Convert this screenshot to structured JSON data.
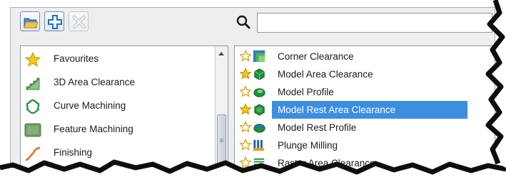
{
  "toolbar": {
    "buttons": [
      {
        "name": "open-folder",
        "icon": "folder-open-icon"
      },
      {
        "name": "add",
        "icon": "plus-icon"
      },
      {
        "name": "remove",
        "icon": "x-icon",
        "disabled": true
      }
    ]
  },
  "search": {
    "icon": "search-icon",
    "value": "",
    "placeholder": ""
  },
  "categories": [
    {
      "label": "Favourites",
      "icon": "star-icon"
    },
    {
      "label": "3D Area Clearance",
      "icon": "area-clearance-icon"
    },
    {
      "label": "Curve Machining",
      "icon": "curve-icon"
    },
    {
      "label": "Feature Machining",
      "icon": "feature-icon"
    },
    {
      "label": "Finishing",
      "icon": "finishing-icon"
    }
  ],
  "strategies": [
    {
      "label": "Corner Clearance",
      "favourite": false,
      "icon": "corner-clearance-icon"
    },
    {
      "label": "Model Area Clearance",
      "favourite": true,
      "icon": "model-area-clearance-icon"
    },
    {
      "label": "Model Profile",
      "favourite": false,
      "icon": "model-profile-icon"
    },
    {
      "label": "Model Rest Area Clearance",
      "favourite": true,
      "selected": true,
      "icon": "model-rest-area-clearance-icon"
    },
    {
      "label": "Model Rest Profile",
      "favourite": false,
      "icon": "model-rest-profile-icon"
    },
    {
      "label": "Plunge Milling",
      "favourite": false,
      "icon": "plunge-milling-icon"
    },
    {
      "label": "Raster Area Clearance",
      "favourite": false,
      "icon": "raster-area-clearance-icon"
    }
  ],
  "colors": {
    "selection": "#3d8ee0",
    "star_gold": "#f5c518",
    "model_green": "#1f8f3a",
    "dialog_bg": "#eceeef"
  }
}
